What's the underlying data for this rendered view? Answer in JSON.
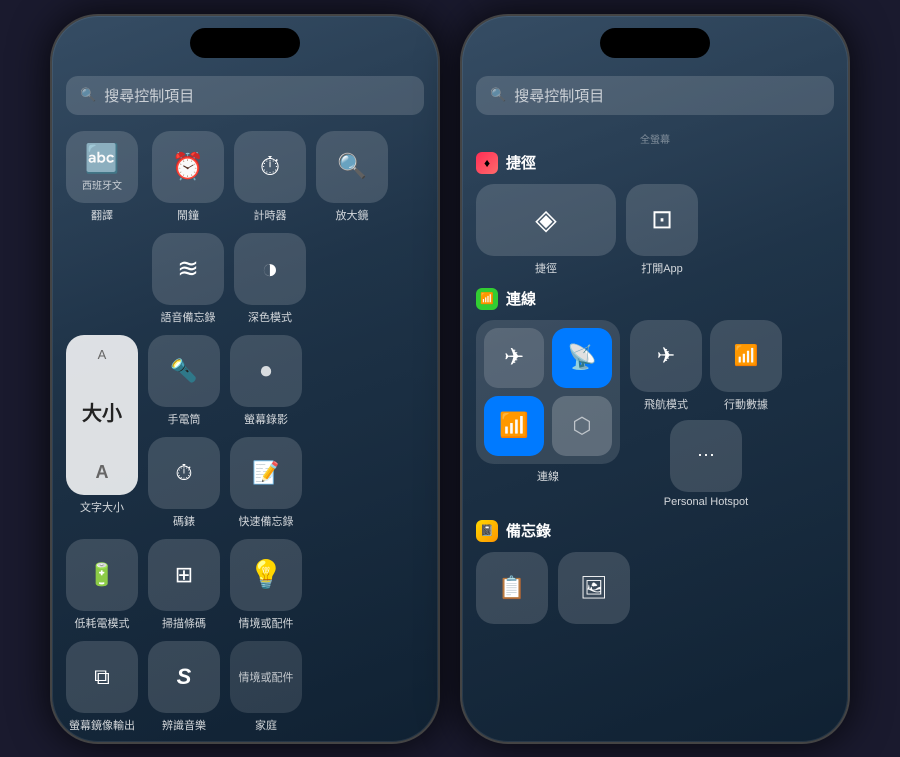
{
  "phones": {
    "left": {
      "search_placeholder": "搜尋控制項目",
      "items": {
        "translate": {
          "label": "翻譯",
          "sublabel": "西班牙文",
          "icon": "🔤"
        },
        "alarm": {
          "label": "鬧鐘",
          "icon": "⏰"
        },
        "timer": {
          "label": "計時器",
          "icon": "⏱"
        },
        "magnifier": {
          "label": "放大鏡",
          "icon": "🔍"
        },
        "voice_memo": {
          "label": "語音備忘錄",
          "icon": "🎙"
        },
        "dark_mode": {
          "label": "深色模式",
          "icon": "◑"
        },
        "text_size": {
          "label": "文字大小",
          "text": "大小"
        },
        "flashlight": {
          "label": "手電筒",
          "icon": "🔦"
        },
        "stopwatch": {
          "label": "碼錶",
          "icon": "⏱"
        },
        "screen_record": {
          "label": "螢幕錄影",
          "icon": "⏺"
        },
        "quick_note": {
          "label": "快速備忘錄",
          "icon": "📝"
        },
        "low_power": {
          "label": "低耗電模式",
          "icon": "🔋"
        },
        "scan_qr": {
          "label": "掃描條碼",
          "icon": "⊞"
        },
        "home": {
          "label": "家庭",
          "icon": "💡"
        },
        "screen_mirror": {
          "label": "螢幕鏡像輸出",
          "icon": "⧉"
        },
        "shazam": {
          "label": "辨識音樂",
          "icon": "S"
        },
        "scene": {
          "label": "情境或配件",
          "icon": ""
        }
      }
    },
    "right": {
      "search_placeholder": "搜尋控制項目",
      "scroll_hint": "全螢幕",
      "sections": {
        "shortcuts": {
          "title": "捷徑",
          "icon": "♦",
          "icon_color": "#FF2D55",
          "items": [
            {
              "label": "捷徑",
              "icon": "◈"
            },
            {
              "label": "打開App",
              "icon": "⊡"
            }
          ]
        },
        "connection": {
          "title": "連線",
          "icon": "📶",
          "icon_color": "#32CD32",
          "connect_label": "連線",
          "items": [
            {
              "label": "飛航模式",
              "icon": "✈",
              "active": false
            },
            {
              "label": "行動數據",
              "icon": "📶",
              "active": false
            },
            {
              "label": "Personal Hotspot",
              "icon": "⋯",
              "active": false
            }
          ],
          "wifi_active": true,
          "hotspot_active": true,
          "airplane": false,
          "cellular_active": false,
          "bluetooth": false
        },
        "notes": {
          "title": "備忘錄",
          "icon": "📓",
          "icon_color": "#FFD700",
          "items": [
            {
              "label": "",
              "icon": "📋"
            },
            {
              "label": "",
              "icon": "🖼"
            }
          ]
        }
      }
    }
  }
}
